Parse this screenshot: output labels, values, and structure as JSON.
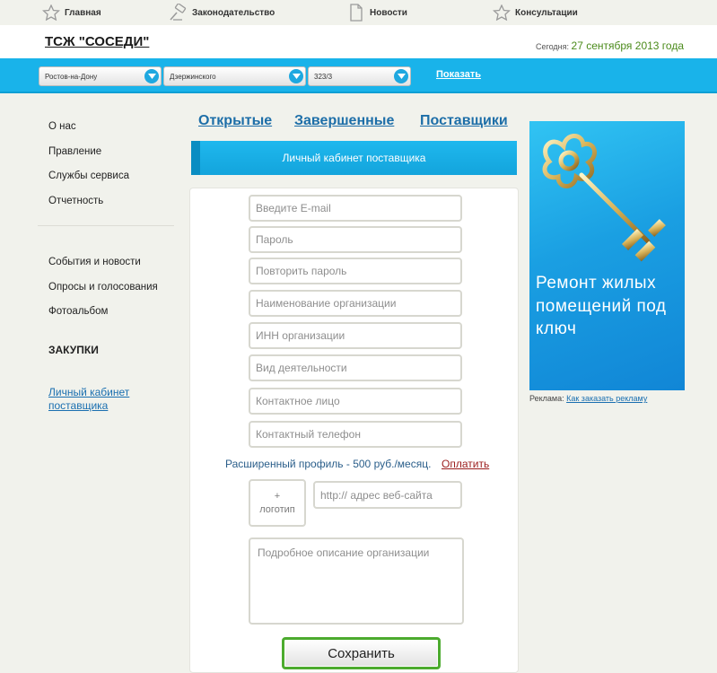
{
  "topnav": {
    "items": [
      {
        "label": "Главная",
        "icon": "star-icon"
      },
      {
        "label": "Законодательство",
        "icon": "gavel-icon"
      },
      {
        "label": "Новости",
        "icon": "document-icon"
      },
      {
        "label": "Консультации",
        "icon": "star-icon"
      }
    ]
  },
  "header": {
    "title": "ТСЖ \"СОСЕДИ\"",
    "today_label": "Сегодня:",
    "today_date": "27 сентября 2013 года"
  },
  "filters": {
    "city": "Ростов-на-Дону",
    "district": "Дзержинского",
    "house": "323/3",
    "show_label": "Показать"
  },
  "sidebar": {
    "group1": [
      "О нас",
      "Правление",
      "Службы сервиса",
      "Отчетность"
    ],
    "group2": [
      "События и новости",
      "Опросы и голосования",
      "Фотоальбом"
    ],
    "heading": "ЗАКУПКИ",
    "cabinet_link": "Личный кабинет поставщика"
  },
  "tabs": [
    "Открытые",
    "Завершенные",
    "Поставщики"
  ],
  "form": {
    "header": "Личный кабинет поставщика",
    "email_placeholder": "Введите E-mail",
    "password_placeholder": "Пароль",
    "repeat_password_placeholder": "Повторить пароль",
    "org_name_placeholder": "Наименование организации",
    "inn_placeholder": "ИНН организации",
    "activity_placeholder": "Вид деятельности",
    "contact_person_placeholder": "Контактное лицо",
    "contact_phone_placeholder": "Контактный телефон",
    "extended_profile_text": "Расширенный профиль - 500 руб./месяц.",
    "pay_label": "Оплатить",
    "logo_plus": "+",
    "logo_label": "логотип",
    "website_placeholder": "http:// адрес веб-сайта",
    "description_placeholder": "Подробное описание организации",
    "save_label": "Сохранить"
  },
  "ad": {
    "text": "Ремонт жилых помещений под ключ",
    "caption_label": "Реклама:",
    "caption_link": "Как заказать рекламу"
  },
  "colors": {
    "accent_blue": "#19b3ea",
    "link_blue": "#1d6ea8",
    "save_border_green": "#4cab2e",
    "pay_red": "#9b1c1c"
  }
}
